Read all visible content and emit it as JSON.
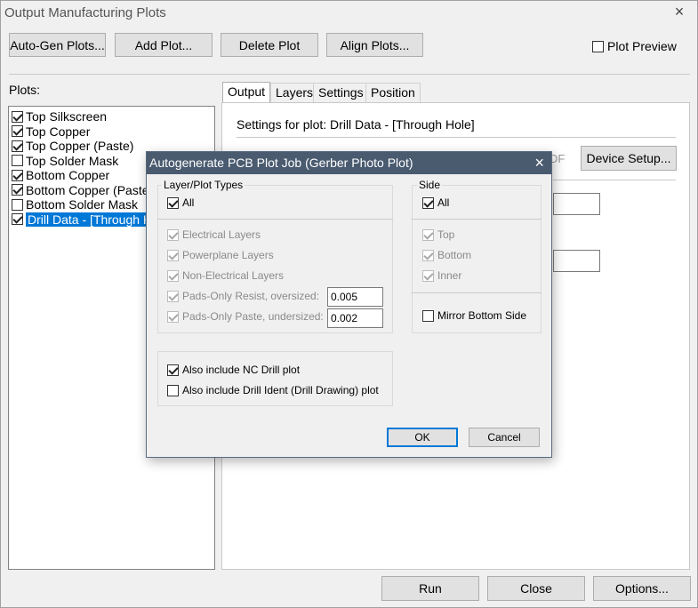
{
  "window": {
    "title": "Output Manufacturing Plots",
    "close": "×"
  },
  "toolbar": {
    "auto_gen": "Auto-Gen Plots...",
    "add": "Add Plot...",
    "delete": "Delete Plot",
    "align": "Align Plots...",
    "plot_preview": "Plot Preview"
  },
  "plots": {
    "label": "Plots:",
    "items": [
      {
        "label": "Top Silkscreen",
        "checked": true
      },
      {
        "label": "Top Copper",
        "checked": true
      },
      {
        "label": "Top Copper (Paste)",
        "checked": true
      },
      {
        "label": "Top Solder Mask",
        "checked": false
      },
      {
        "label": "Bottom Copper",
        "checked": true
      },
      {
        "label": "Bottom Copper (Paste)",
        "checked": true
      },
      {
        "label": "Bottom Solder Mask",
        "checked": false
      },
      {
        "label": "Drill Data - [Through Ho",
        "checked": true,
        "selected": true
      }
    ]
  },
  "tabs": [
    "Output",
    "Layers",
    "Settings",
    "Position"
  ],
  "settings_title": "Settings for plot: Drill Data - [Through Hole]",
  "partial_text": "DF",
  "device_setup": "Device Setup...",
  "footer": {
    "run": "Run",
    "close": "Close",
    "options": "Options..."
  },
  "dialog": {
    "title": "Autogenerate PCB Plot Job (Gerber Photo Plot)",
    "close": "×",
    "layer_group": {
      "label": "Layer/Plot Types",
      "all": "All",
      "options": [
        "Electrical Layers",
        "Powerplane Layers",
        "Non-Electrical Layers",
        "Pads-Only Resist, oversized:",
        "Pads-Only Paste, undersized:"
      ],
      "resist_value": "0.005",
      "paste_value": "0.002"
    },
    "side_group": {
      "label": "Side",
      "all": "All",
      "options": [
        "Top",
        "Bottom",
        "Inner"
      ],
      "mirror": "Mirror Bottom Side"
    },
    "extra": {
      "nc_drill": "Also include NC Drill plot",
      "drill_ident": "Also include Drill Ident (Drill Drawing) plot"
    },
    "ok": "OK",
    "cancel": "Cancel"
  }
}
